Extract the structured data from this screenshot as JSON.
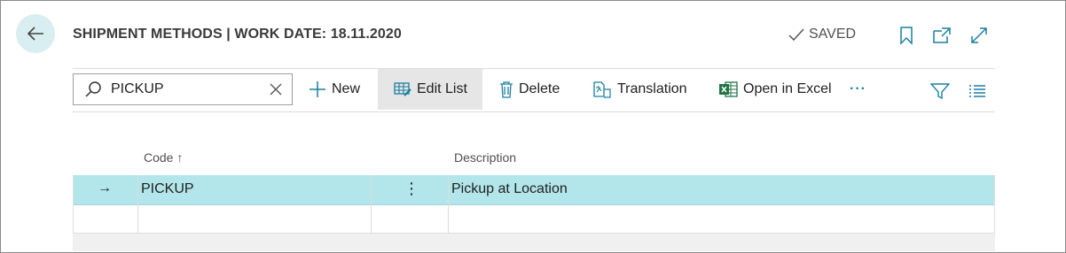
{
  "header": {
    "title": "SHIPMENT METHODS | WORK DATE: 18.11.2020",
    "saved": "SAVED"
  },
  "search": {
    "value": "PICKUP"
  },
  "actions": {
    "new": "New",
    "edit_list": "Edit List",
    "delete": "Delete",
    "translation": "Translation",
    "open_in_excel": "Open in Excel",
    "more": "···"
  },
  "table": {
    "columns": {
      "code": "Code",
      "code_sort": "↑",
      "description": "Description"
    },
    "rows": [
      {
        "indicator": "→",
        "code": "PICKUP",
        "menu": "⋮",
        "description": "Pickup at Location"
      }
    ]
  },
  "colors": {
    "accent": "#b2e6ea",
    "back_bg": "#d9eef0",
    "excel_green": "#217346"
  },
  "icons": [
    "back-arrow-icon",
    "checkmark-icon",
    "bookmark-icon",
    "open-new-window-icon",
    "expand-icon",
    "search-icon",
    "clear-icon",
    "plus-icon",
    "edit-list-icon",
    "trash-icon",
    "translation-icon",
    "excel-icon",
    "filter-icon",
    "list-view-icon"
  ]
}
